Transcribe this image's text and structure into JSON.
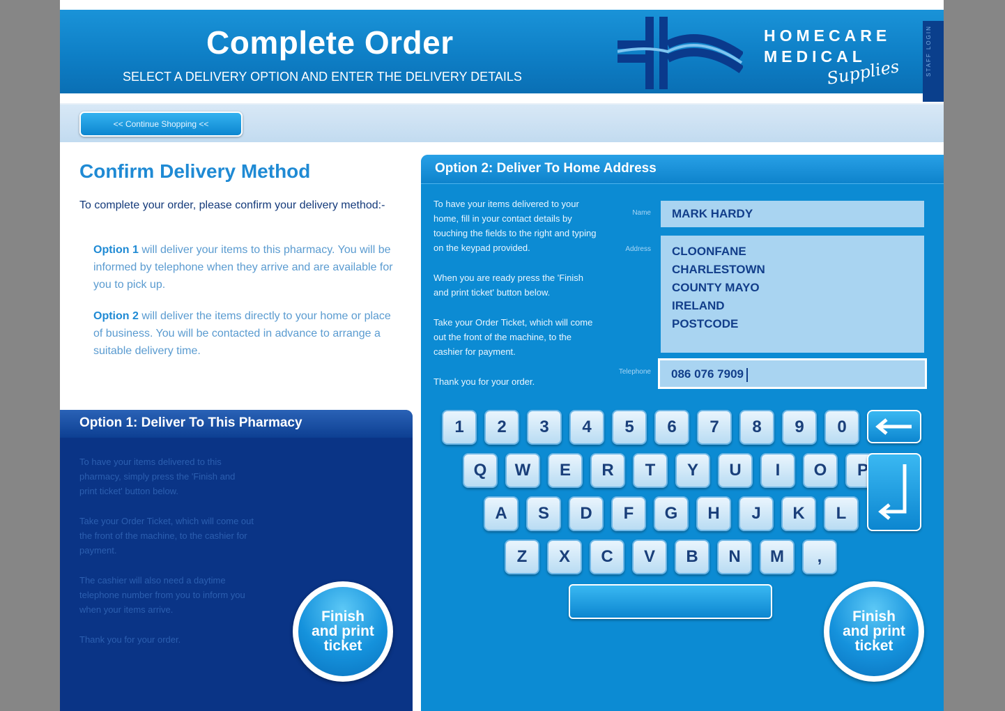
{
  "header": {
    "title": "Complete Order",
    "subtitle": "SELECT A DELIVERY OPTION AND ENTER THE DELIVERY DETAILS",
    "logo_line1": "HOMECARE",
    "logo_line2": "MEDICAL",
    "logo_line3": "Supplies",
    "staff_login": "STAFF LOGIN"
  },
  "nav": {
    "continue_label": "<< Continue Shopping <<"
  },
  "confirm": {
    "title": "Confirm Delivery Method",
    "intro": "To complete your order, please confirm your delivery method:-",
    "option1_lead": "Option 1",
    "option1_rest": " will deliver your items to this pharmacy. You will be informed by telephone when they arrive and are available for you to pick up.",
    "option2_lead": "Option 2",
    "option2_rest": " will deliver the items directly to your home or place of business. You will be contacted in advance to arrange a suitable delivery time."
  },
  "option1": {
    "title": "Option 1: Deliver To This Pharmacy",
    "paragraphs": [
      "To have your items delivered to this pharmacy, simply press the 'Finish and print ticket' button below.",
      "Take your Order Ticket, which will come out the front of the machine, to the cashier for payment.",
      "The cashier will also need a daytime telephone number from you to inform you when your items arrive.",
      "Thank you for your order."
    ],
    "finish_line1": "Finish",
    "finish_line2": "and print",
    "finish_line3": "ticket"
  },
  "option2": {
    "title": "Option 2: Deliver To Home Address",
    "paragraphs": [
      "To have your items delivered to your home, fill in your contact details by touching the fields to the right and typing on the keypad provided.",
      "When you are ready press the 'Finish and print ticket' button below.",
      "Take your Order Ticket, which will come out the front of the machine, to the cashier for payment.",
      "Thank you for your order."
    ],
    "name_label": "Name",
    "name_value": "MARK HARDY",
    "address_label": "Address",
    "address_lines": [
      "CLOONFANE",
      "CHARLESTOWN",
      "COUNTY MAYO",
      "IRELAND",
      "POSTCODE"
    ],
    "phone_label": "Telephone",
    "phone_value": "086 076 7909",
    "finish_line1": "Finish",
    "finish_line2": "and print",
    "finish_line3": "ticket"
  },
  "keyboard": {
    "row1": [
      "1",
      "2",
      "3",
      "4",
      "5",
      "6",
      "7",
      "8",
      "9",
      "0"
    ],
    "row2": [
      "Q",
      "W",
      "E",
      "R",
      "T",
      "Y",
      "U",
      "I",
      "O",
      "P"
    ],
    "row3": [
      "A",
      "S",
      "D",
      "F",
      "G",
      "H",
      "J",
      "K",
      "L"
    ],
    "row4": [
      "Z",
      "X",
      "C",
      "V",
      "B",
      "N",
      "M",
      ","
    ]
  },
  "colors": {
    "brand_blue": "#0e7fc6",
    "dark_navy": "#0a3486",
    "title_blue": "#1f8ad4",
    "field_bg": "#a9d4f1"
  }
}
